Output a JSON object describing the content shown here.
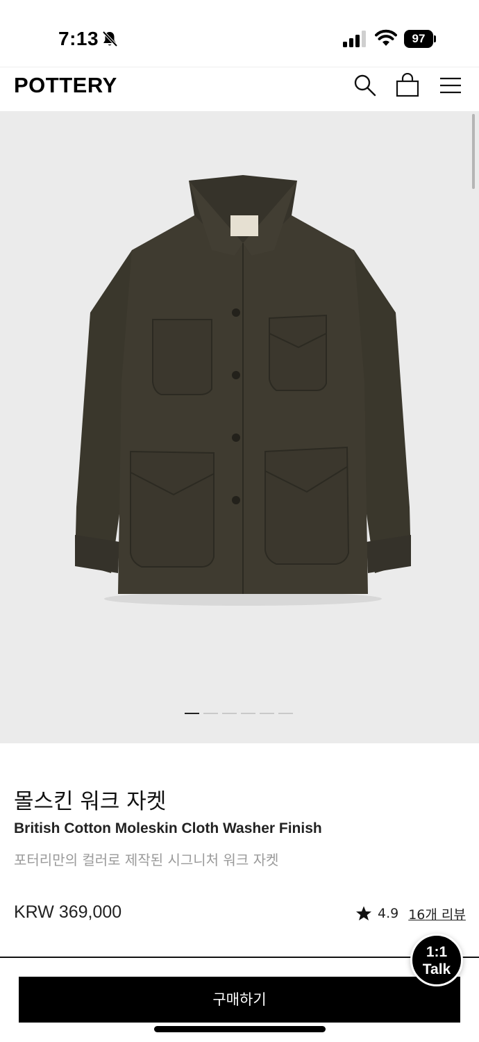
{
  "status_bar": {
    "time": "7:13",
    "battery": "97",
    "icons": [
      "bell-off-icon",
      "signal-icon",
      "wifi-icon",
      "battery-icon"
    ]
  },
  "header": {
    "logo": "POTTERY",
    "icons": [
      "search-icon",
      "shopping-bag-icon",
      "hamburger-menu-icon"
    ]
  },
  "gallery": {
    "image": "moleskin-work-jacket-photo",
    "slide_count": 6,
    "active_slide": 1,
    "background": "#ebebeb"
  },
  "product": {
    "name_ko": "몰스킨 워크 자켓",
    "name_en": "British Cotton Moleskin Cloth Washer Finish",
    "subtitle": "포터리만의 컬러로 제작된 시그니처 워크 자켓",
    "price": "KRW 369,000",
    "rating": "4.9",
    "review_count": "16",
    "review_suffix": "개 리뷰"
  },
  "chat": {
    "line1": "1:1",
    "line2": "Talk"
  },
  "buy_button": {
    "label": "구매하기"
  },
  "colors": {
    "jacket": "#3e3a2f",
    "accent": "#000000"
  }
}
